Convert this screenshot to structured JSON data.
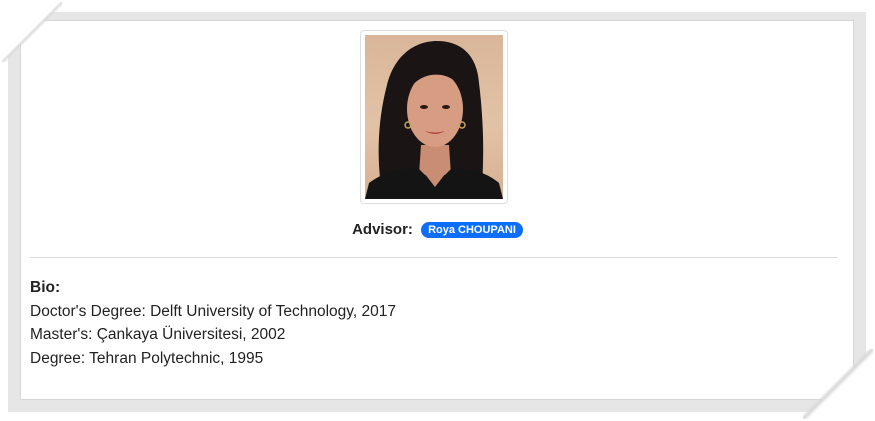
{
  "profile": {
    "photo_alt": "Roya CHOUPANI",
    "advisor_label": "Advisor:",
    "advisor_name": "Roya CHOUPANI"
  },
  "bio": {
    "heading": "Bio:",
    "lines": [
      "Doctor's Degree: Delft University of Technology, 2017",
      "Master's: Çankaya Üniversitesi, 2002",
      "Degree: Tehran Polytechnic, 1995"
    ]
  },
  "colors": {
    "badge": "#0d6efd",
    "divider": "#dcdcdc"
  }
}
